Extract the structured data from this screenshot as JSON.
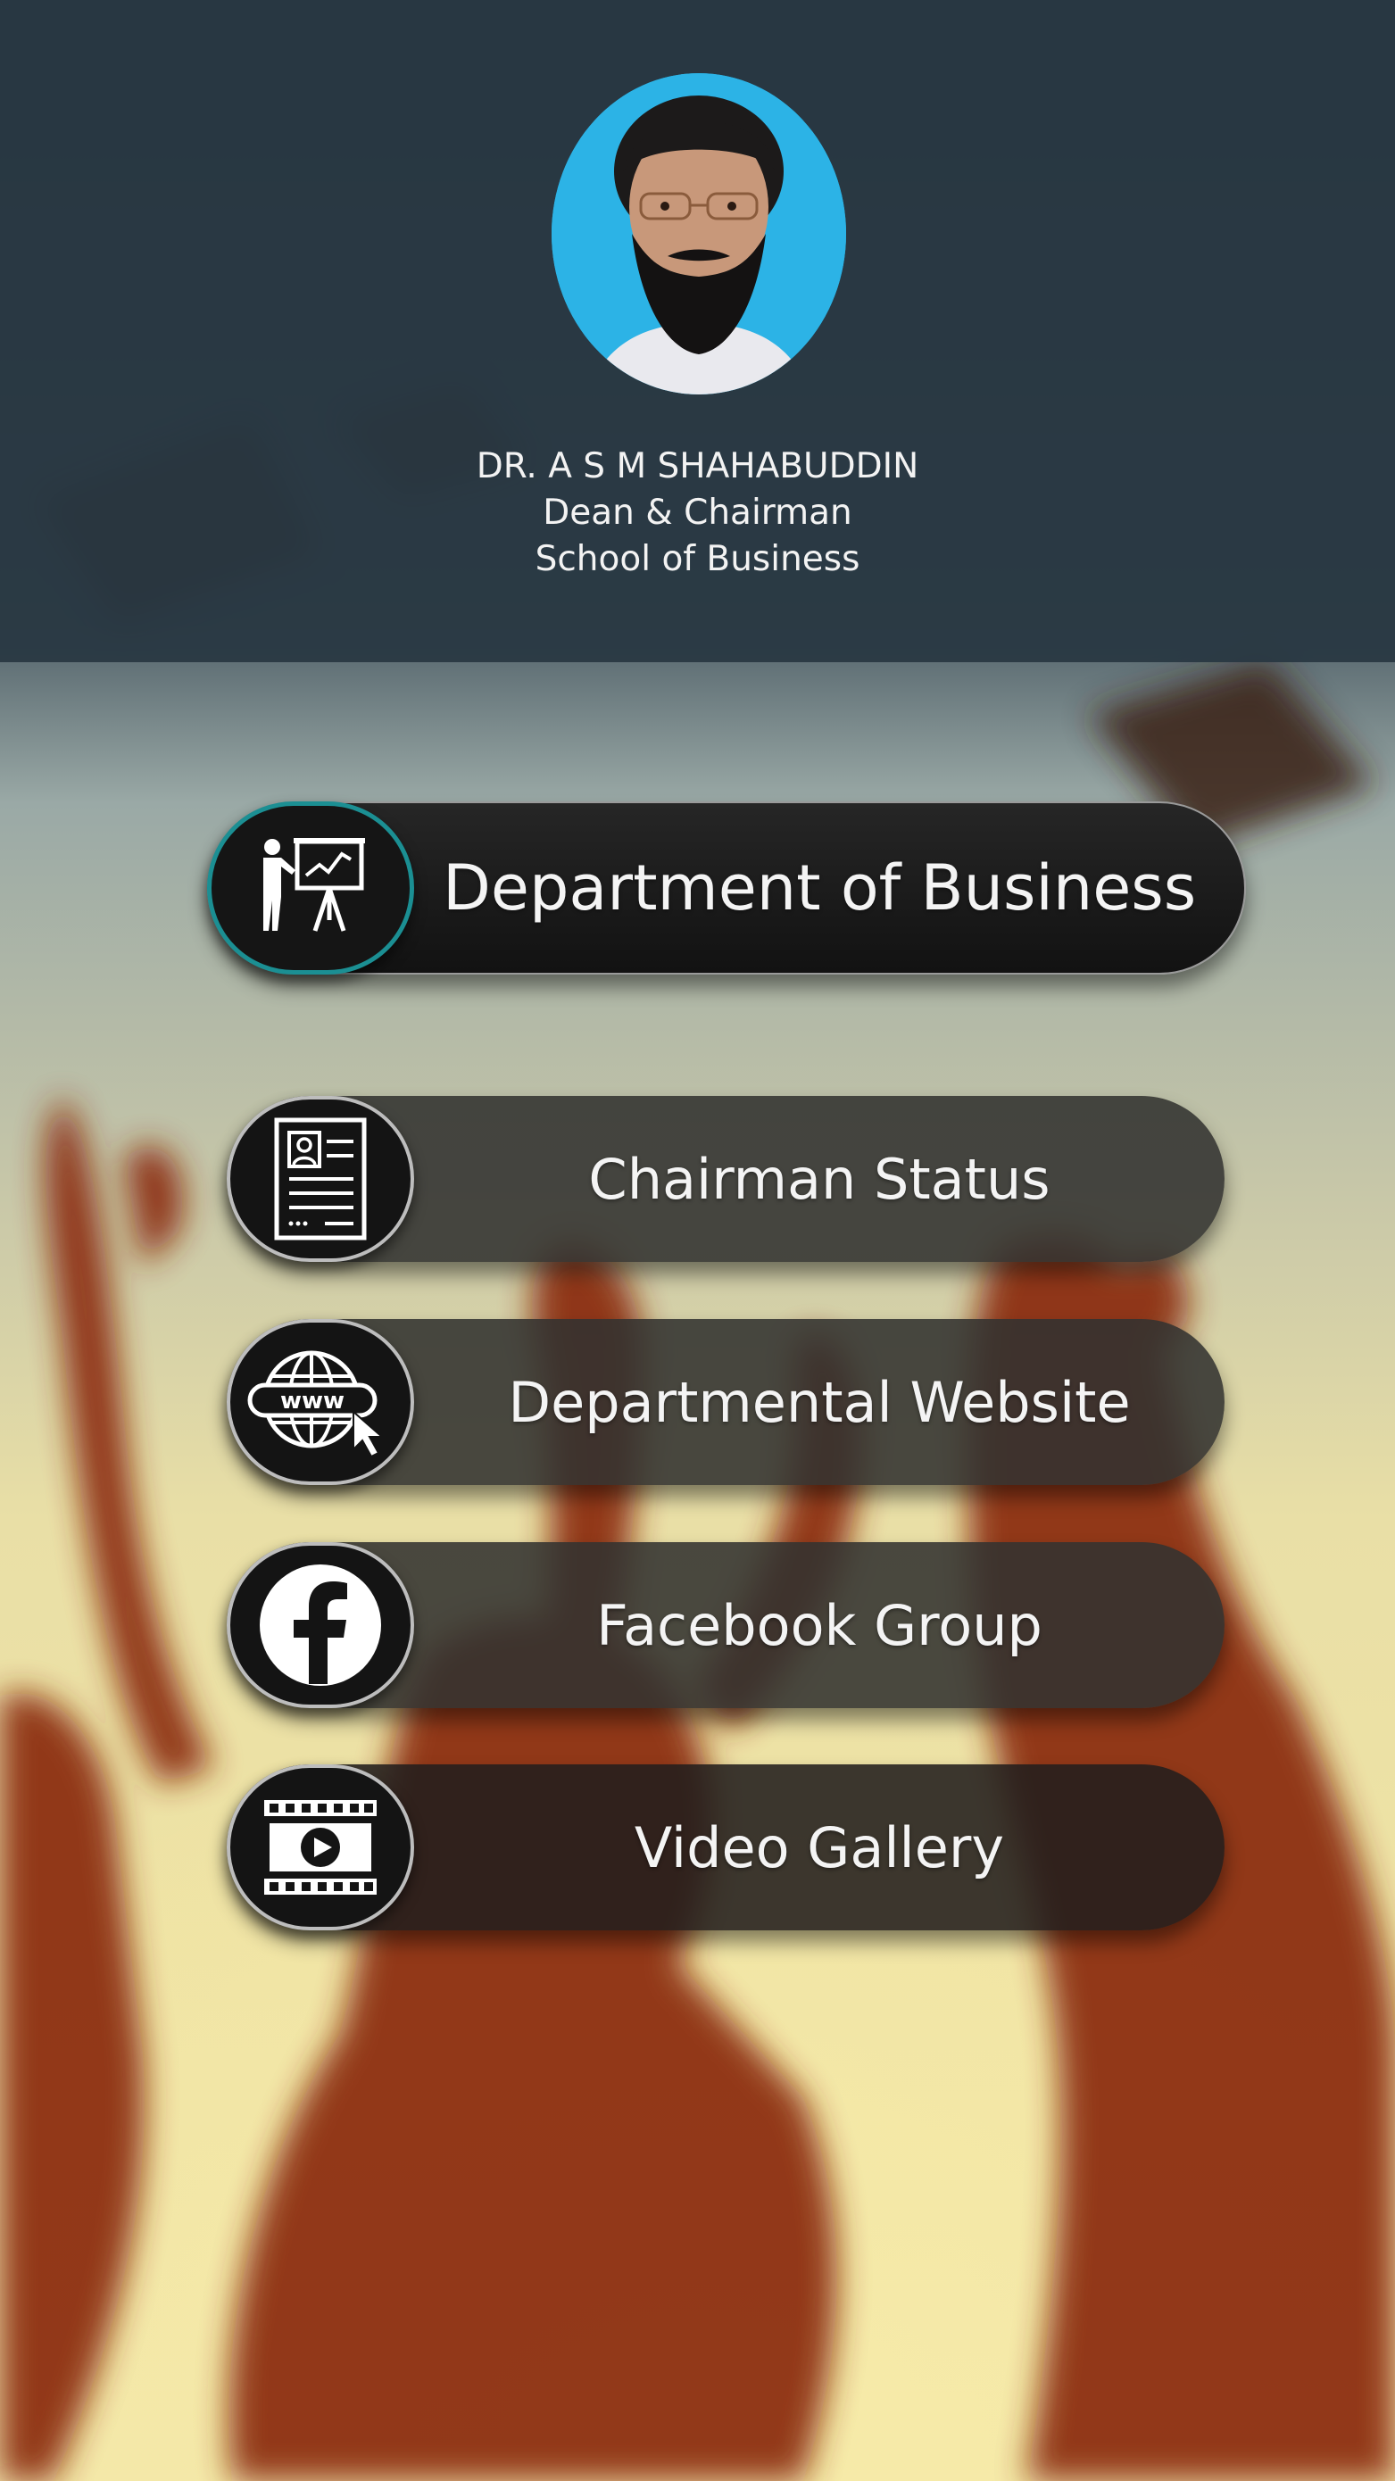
{
  "profile": {
    "name": "DR. A S M SHAHABUDDIN",
    "role": "Dean & Chairman",
    "school": "School of Business"
  },
  "menu": {
    "primary": {
      "label": "Department of Business",
      "icon": "presentation-icon",
      "accent": "#1b8f93"
    },
    "items": [
      {
        "label": "Chairman Status",
        "icon": "profile-document-icon"
      },
      {
        "label": "Departmental Website",
        "icon": "www-globe-icon"
      },
      {
        "label": "Facebook Group",
        "icon": "facebook-icon"
      },
      {
        "label": "Video Gallery",
        "icon": "video-film-icon"
      }
    ]
  },
  "colors": {
    "header": "#283742",
    "avatar_bg": "#2cb3e6",
    "button_dark": "#141414",
    "text": "#f4f4f4"
  }
}
